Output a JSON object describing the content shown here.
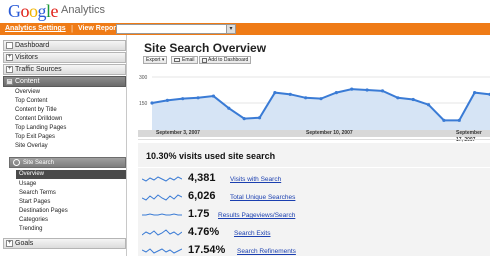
{
  "header": {
    "logo_letters": [
      "G",
      "o",
      "o",
      "g",
      "l",
      "e"
    ],
    "logo_colors": [
      "#2a5bd7",
      "#e0231b",
      "#f0b400",
      "#2a5bd7",
      "#1a9a35",
      "#e0231b"
    ],
    "product": "Analytics"
  },
  "topbar": {
    "settings_link": "Analytics Settings",
    "separator": "|",
    "view_reports_label": "View Reports:",
    "select_value": ""
  },
  "sidebar": {
    "dashboard": "Dashboard",
    "visitors": "Visitors",
    "traffic_sources": "Traffic Sources",
    "content": "Content",
    "content_items": [
      "Overview",
      "Top Content",
      "Content by Title",
      "Content Drilldown",
      "Top Landing Pages",
      "Top Exit Pages",
      "Site Overlay"
    ],
    "site_search": "Site Search",
    "site_search_items": [
      "Overview",
      "Usage",
      "Search Terms",
      "Start Pages",
      "Destination Pages",
      "Categories",
      "Trending"
    ],
    "goals": "Goals"
  },
  "main": {
    "title": "Site Search Overview",
    "toolbar": {
      "export": "Export ▾",
      "email": "Email",
      "add_dashboard": "Add to Dashboard"
    },
    "visits_summary": "10.30% visits used site search"
  },
  "chart_data": {
    "type": "area",
    "y_tick_labels": [
      "300",
      "150"
    ],
    "x_tick_labels": [
      "September 3, 2007",
      "September 10, 2007",
      "September 17, 2007"
    ],
    "ylim": [
      0,
      300
    ],
    "values": [
      150,
      165,
      175,
      180,
      190,
      120,
      60,
      65,
      210,
      200,
      180,
      175,
      210,
      230,
      225,
      220,
      180,
      170,
      140,
      50,
      50,
      210,
      200
    ],
    "color": "#3a7bd5",
    "fill_color": "#d6e4f5"
  },
  "metrics": [
    {
      "value": "4,381",
      "label": "Visits with Search"
    },
    {
      "value": "6,026",
      "label": "Total Unique Searches"
    },
    {
      "value": "1.75",
      "label": "Results Pageviews/Search"
    },
    {
      "value": "4.76%",
      "label": "Search Exits"
    },
    {
      "value": "17.54%",
      "label": "Search Refinements"
    }
  ]
}
